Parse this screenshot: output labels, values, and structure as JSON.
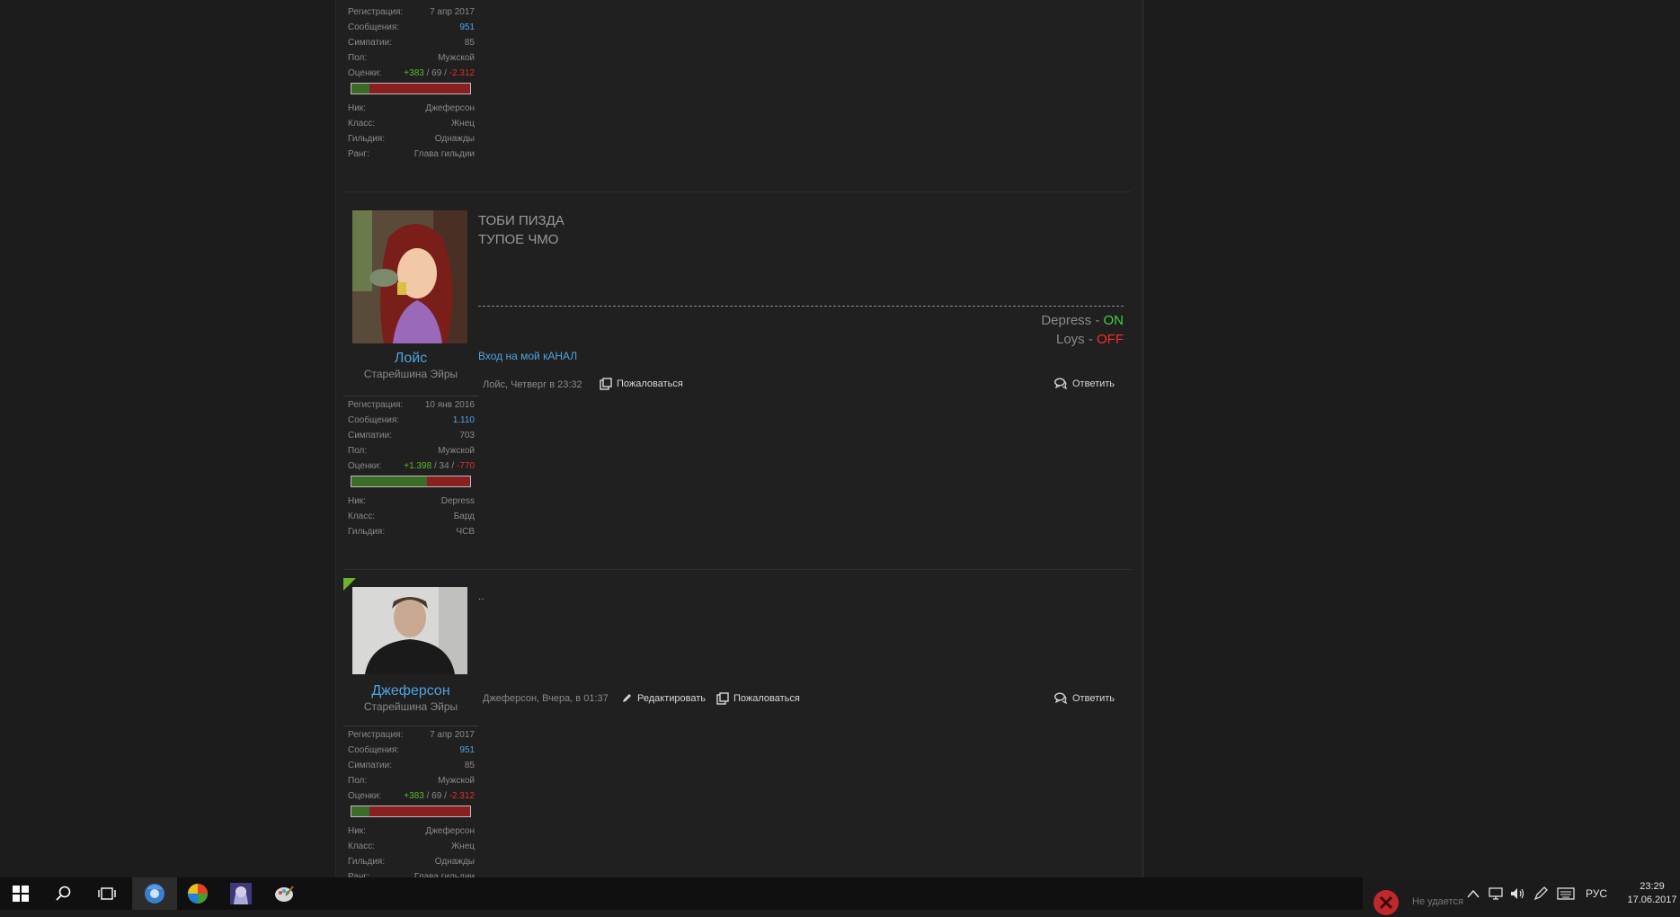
{
  "posts": [
    {
      "stats": [
        {
          "k": "Регистрация:",
          "v": "7 апр 2017"
        },
        {
          "k": "Сообщения:",
          "v": "951",
          "color": "blue"
        },
        {
          "k": "Симпатии:",
          "v": "85"
        },
        {
          "k": "Пол:",
          "v": "Мужской"
        }
      ],
      "ratings": {
        "label": "Оценки:",
        "pos": "+383",
        "neu": "69",
        "neg": "-2.312",
        "pos_fraction": 0.15
      },
      "extra": [
        {
          "k": "Ник:",
          "v": "Джеферсон"
        },
        {
          "k": "Класс:",
          "v": "Жнец"
        },
        {
          "k": "Гильдия:",
          "v": "Однажды"
        },
        {
          "k": "Ранг:",
          "v": "Глава гильдии"
        }
      ]
    },
    {
      "name": "Лойс",
      "title": "Старейшина Эйры",
      "lines": [
        "ТОБИ ПИЗДА",
        "ТУПОЕ ЧМО"
      ],
      "sig": [
        {
          "name": "Depress - ",
          "state": "ON",
          "state_color": "#3fd13f"
        },
        {
          "name": "Loys - ",
          "state": "OFF",
          "state_color": "#ff2a2a"
        }
      ],
      "link": "Вход на мой кАНАЛ",
      "meta": "Лойс, Четверг в 23:32",
      "report": "Пожаловаться",
      "reply": "Ответить",
      "stats": [
        {
          "k": "Регистрация:",
          "v": "10 янв 2016"
        },
        {
          "k": "Сообщения:",
          "v": "1.110",
          "color": "blue"
        },
        {
          "k": "Симпатии:",
          "v": "703"
        },
        {
          "k": "Пол:",
          "v": "Мужской"
        }
      ],
      "ratings": {
        "label": "Оценки:",
        "pos": "+1.398",
        "neu": "34",
        "neg": "-770",
        "pos_fraction": 0.64
      },
      "extra": [
        {
          "k": "Ник:",
          "v": "Depress"
        },
        {
          "k": "Класс:",
          "v": "Бард"
        },
        {
          "k": "Гильдия:",
          "v": "ЧСВ"
        }
      ]
    },
    {
      "name": "Джеферсон",
      "title": "Старейшина Эйры",
      "lines": [
        ".."
      ],
      "meta": "Джеферсон, Вчера, в 01:37",
      "edit": "Редактировать",
      "report": "Пожаловаться",
      "reply": "Ответить",
      "stats": [
        {
          "k": "Регистрация:",
          "v": "7 апр 2017"
        },
        {
          "k": "Сообщения:",
          "v": "951",
          "color": "blue"
        },
        {
          "k": "Симпатии:",
          "v": "85"
        },
        {
          "k": "Пол:",
          "v": "Мужской"
        }
      ],
      "ratings": {
        "label": "Оценки:",
        "pos": "+383",
        "neu": "69",
        "neg": "-2.312",
        "pos_fraction": 0.15
      },
      "extra": [
        {
          "k": "Ник:",
          "v": "Джеферсон"
        },
        {
          "k": "Класс:",
          "v": "Жнец"
        },
        {
          "k": "Гильдия:",
          "v": "Однажды"
        },
        {
          "k": "Ранг:",
          "v": "Глава гильдии"
        }
      ]
    }
  ],
  "taskbar": {
    "language": "РУС",
    "time": "23:29",
    "date": "17.06.2017",
    "notification": "Не удается"
  }
}
